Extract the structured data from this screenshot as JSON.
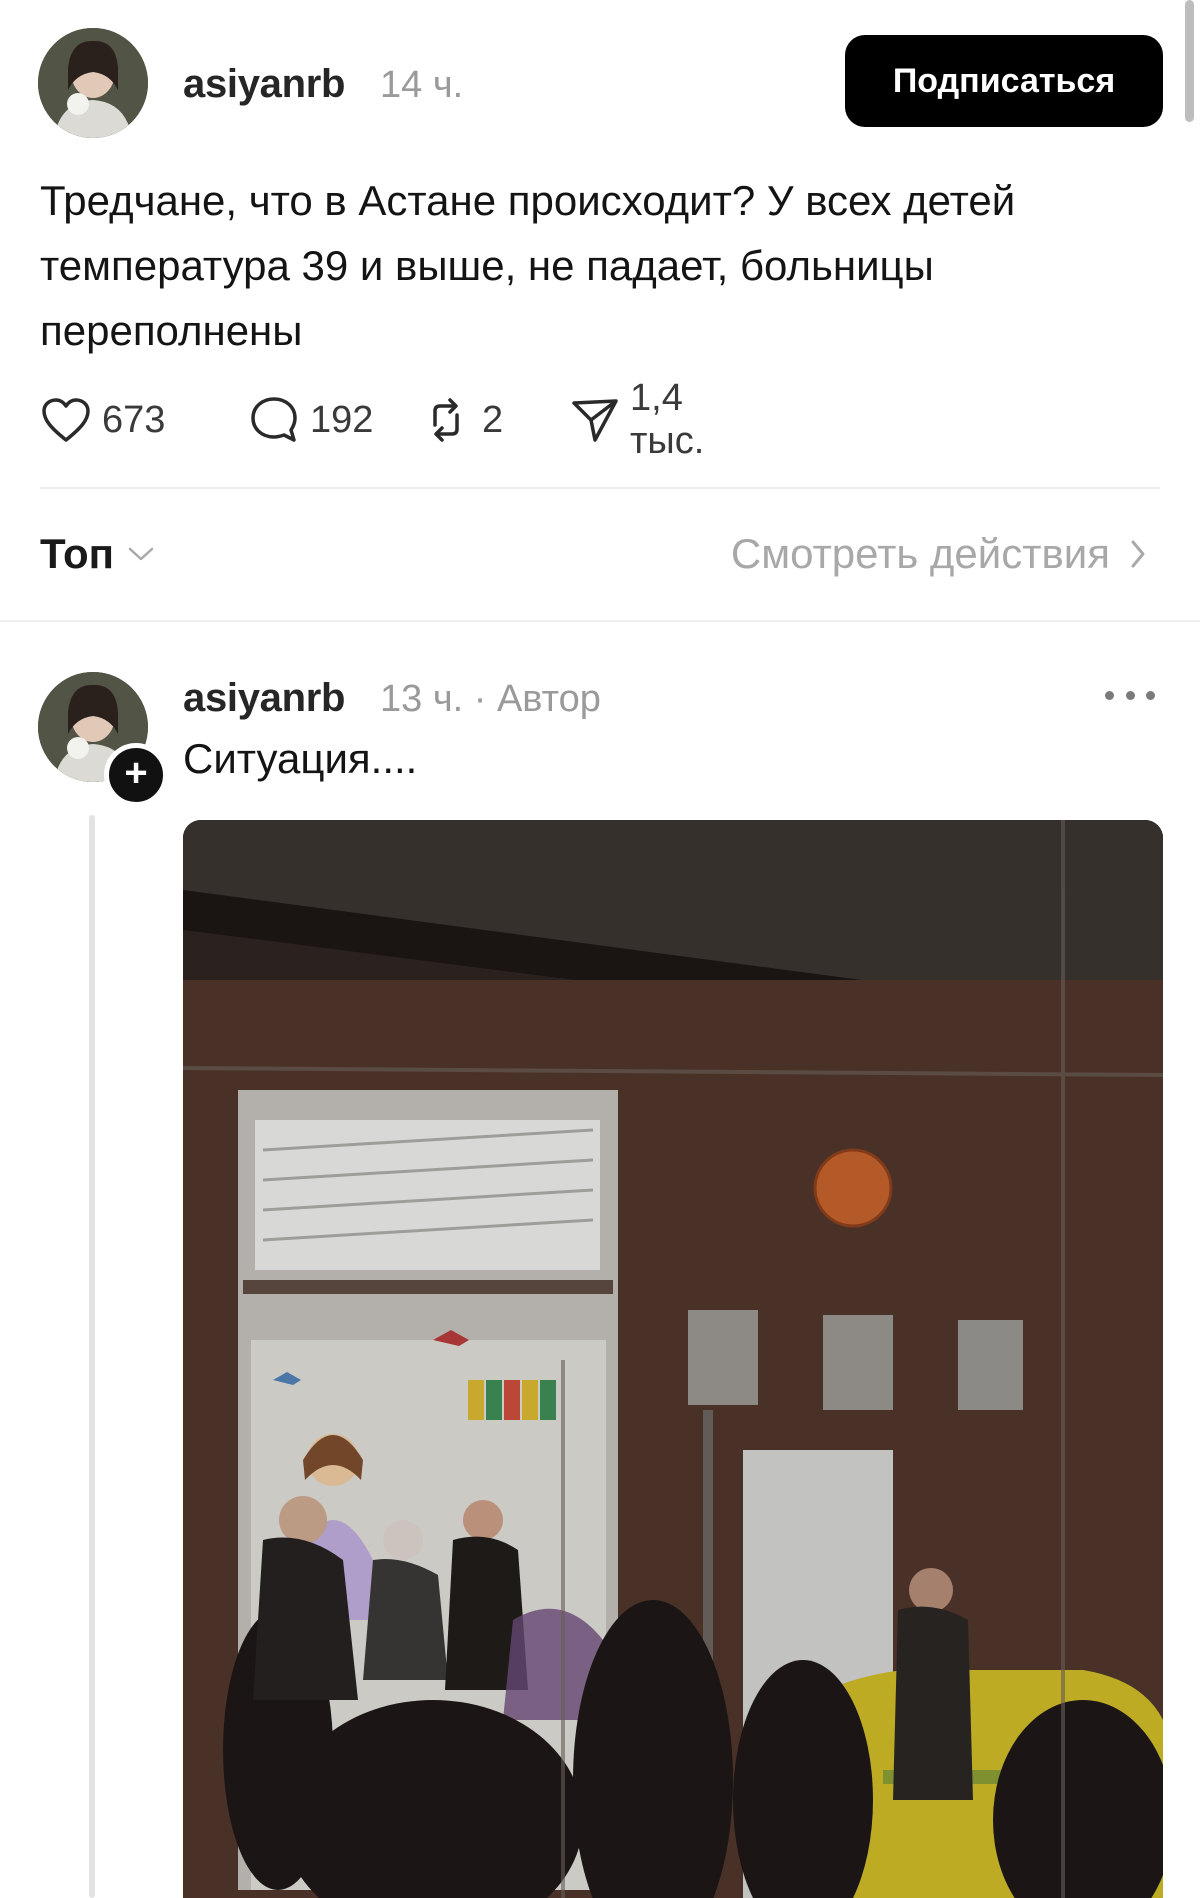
{
  "post": {
    "username": "asiyanrb",
    "time": "14 ч.",
    "follow_label": "Подписаться",
    "text": "Тредчане, что в Астане происходит? У всех детей температура 39 и выше, не падает, больницы переполнены",
    "stats": {
      "likes": "673",
      "comments": "192",
      "reposts": "2",
      "shares": "1,4 тыс."
    }
  },
  "controls": {
    "sort_label": "Топ",
    "activity_label": "Смотреть действия"
  },
  "reply": {
    "username": "asiyanrb",
    "meta": "13 ч. · Автор",
    "text": "Ситуация...."
  },
  "icons": {
    "like": "heart-icon",
    "comment": "comment-bubble-icon",
    "repost": "repost-icon",
    "share": "send-icon",
    "sort": "chevron-down-icon",
    "activity": "chevron-right-icon",
    "more": "more-dots-icon",
    "follow": "plus-icon"
  }
}
